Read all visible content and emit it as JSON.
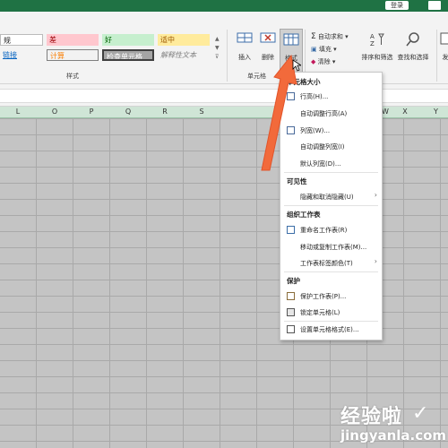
{
  "titlebar": {
    "login": "登录"
  },
  "styles": {
    "row1": [
      "规",
      "差",
      "好",
      "适中"
    ],
    "row2": [
      "链接",
      "计算",
      "检查单元格",
      "解释性文本"
    ],
    "group_label": "样式"
  },
  "cells_group": {
    "insert": "插入",
    "delete": "删除",
    "format": "格式",
    "group_label": "单元格"
  },
  "editing_group": {
    "autosum": "自动求和",
    "fill": "填充",
    "clear": "清除",
    "sort_filter": "排序和筛选",
    "find_select": "查找和选择",
    "right_partial": "发"
  },
  "columns": [
    "L",
    "O",
    "P",
    "Q",
    "R",
    "S",
    "W",
    "X",
    "Y"
  ],
  "menu": {
    "cell_size_title": "单元格大小",
    "row_height": "行高(H)...",
    "autofit_row": "自动调整行高(A)",
    "col_width": "列宽(W)...",
    "autofit_col": "自动调整列宽(I)",
    "default_width": "默认列宽(D)...",
    "visibility_title": "可见性",
    "hide_unhide": "隐藏和取消隐藏(U)",
    "organize_title": "组织工作表",
    "rename": "重命名工作表(R)",
    "move_copy": "移动或复制工作表(M)...",
    "tab_color": "工作表标签颜色(T)",
    "protect_title": "保护",
    "protect_sheet": "保护工作表(P)...",
    "lock_cell": "锁定单元格(L)",
    "format_cells": "设置单元格格式(E)..."
  },
  "watermark": {
    "cn": "经验啦",
    "en": "jingyanla.com"
  },
  "colors": {
    "excel_green": "#1f7244",
    "arrow": "#f26a3b"
  }
}
